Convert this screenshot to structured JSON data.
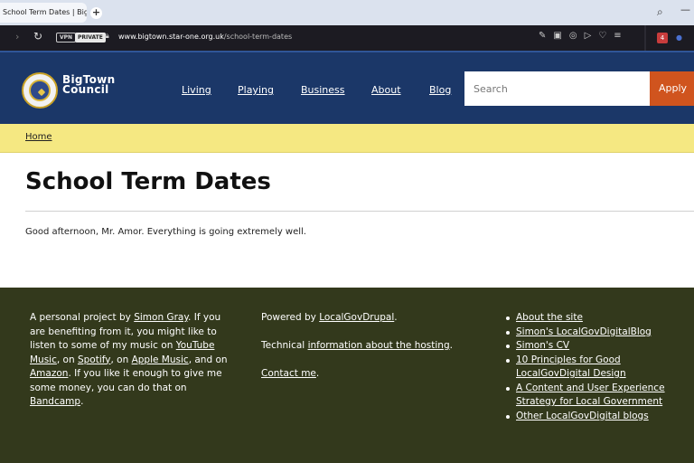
{
  "browser": {
    "tab_title": "School Term Dates | BigTo",
    "new_tab": "+",
    "vpn_label": "VPN",
    "private_label": "PRIVATE",
    "url_host": "www.bigtown.star-one.org.uk",
    "url_path": "/school-term-dates",
    "extension_badge": "4"
  },
  "header": {
    "logo_line1": "BigTown",
    "logo_line2": "Council",
    "nav": [
      {
        "label": "Living"
      },
      {
        "label": "Playing"
      },
      {
        "label": "Business"
      },
      {
        "label": "About"
      },
      {
        "label": "Blog"
      }
    ],
    "search_placeholder": "Search",
    "apply_label": "Apply"
  },
  "breadcrumb": {
    "home": "Home"
  },
  "main": {
    "title": "School Term Dates",
    "greeting": "Good afternoon, Mr. Amor. Everything is going extremely well."
  },
  "footer": {
    "col1": {
      "t1": "A personal project by ",
      "l1": "Simon Gray",
      "t2": ". If you are benefiting from it, you might like to listen to some of my music on ",
      "l2": "YouTube Music",
      "t3": ", on ",
      "l3": "Spotify",
      "t4": ", on ",
      "l4": "Apple Music",
      "t5": ", and on ",
      "l5": "Amazon",
      "t6": ". If you like it enough to give me some money, you can do that on ",
      "l6": "Bandcamp",
      "t7": "."
    },
    "col2": {
      "powered_text": "Powered by ",
      "powered_link": "LocalGovDrupal",
      "powered_end": ".",
      "tech_text": "Technical ",
      "tech_link": "information about the hosting",
      "tech_end": ".",
      "contact_link": "Contact me",
      "contact_end": "."
    },
    "links": [
      "About the site",
      "Simon's LocalGovDigitalBlog",
      "Simon's CV",
      "10 Principles for Good LocalGovDigital Design",
      "A Content and User Experience Strategy for Local Government",
      "Other LocalGovDigital blogs"
    ]
  }
}
